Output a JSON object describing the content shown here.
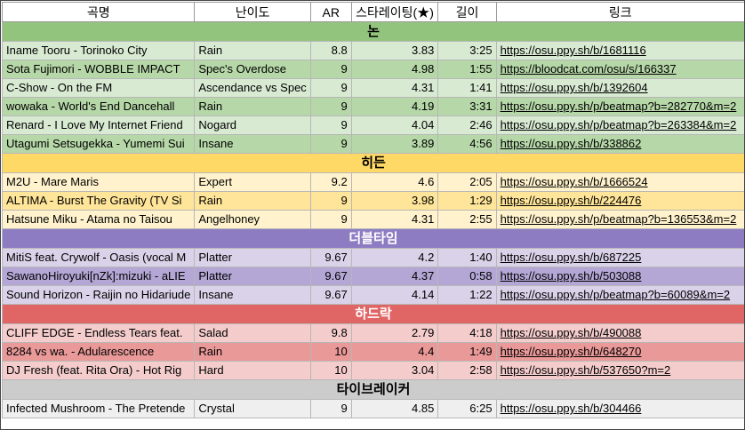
{
  "headers": {
    "song": "곡명",
    "difficulty": "난이도",
    "ar": "AR",
    "star_rating": "스타레이팅(★)",
    "length": "길이",
    "link": "링크"
  },
  "sections": {
    "nomod": {
      "title": "논",
      "rows": [
        {
          "song": "Iname Tooru - Torinoko City",
          "difficulty": "Rain",
          "ar": "8.8",
          "stars": "3.83",
          "length": "3:25",
          "link": "https://osu.ppy.sh/b/1681116"
        },
        {
          "song": "Sota Fujimori - WOBBLE IMPACT",
          "difficulty": "Spec's Overdose",
          "ar": "9",
          "stars": "4.98",
          "length": "1:55",
          "link": "https://bloodcat.com/osu/s/166337"
        },
        {
          "song": "C-Show - On the FM",
          "difficulty": "Ascendance vs Spec",
          "ar": "9",
          "stars": "4.31",
          "length": "1:41",
          "link": "https://osu.ppy.sh/b/1392604"
        },
        {
          "song": "wowaka - World's End Dancehall",
          "difficulty": "Rain",
          "ar": "9",
          "stars": "4.19",
          "length": "3:31",
          "link": "https://osu.ppy.sh/p/beatmap?b=282770&m=2"
        },
        {
          "song": "Renard - I Love My Internet Friend",
          "difficulty": "Nogard",
          "ar": "9",
          "stars": "4.04",
          "length": "2:46",
          "link": "https://osu.ppy.sh/p/beatmap?b=263384&m=2"
        },
        {
          "song": "Utagumi Setsugekka - Yumemi Sui",
          "difficulty": "Insane",
          "ar": "9",
          "stars": "3.89",
          "length": "4:56",
          "link": "https://osu.ppy.sh/b/338862"
        }
      ]
    },
    "hidden": {
      "title": "히든",
      "rows": [
        {
          "song": "M2U - Mare Maris",
          "difficulty": "Expert",
          "ar": "9.2",
          "stars": "4.6",
          "length": "2:05",
          "link": "https://osu.ppy.sh/b/1666524"
        },
        {
          "song": "ALTIMA - Burst The Gravity (TV Si",
          "difficulty": "Rain",
          "ar": "9",
          "stars": "3.98",
          "length": "1:29",
          "link": "https://osu.ppy.sh/b/224476"
        },
        {
          "song": "Hatsune Miku - Atama no Taisou",
          "difficulty": "Angelhoney",
          "ar": "9",
          "stars": "4.31",
          "length": "2:55",
          "link": "https://osu.ppy.sh/p/beatmap?b=136553&m=2"
        }
      ]
    },
    "doubletime": {
      "title": "더블타임",
      "rows": [
        {
          "song": "MitiS feat. Crywolf - Oasis (vocal M",
          "difficulty": "Platter",
          "ar": "9.67",
          "stars": "4.2",
          "length": "1:40",
          "link": "https://osu.ppy.sh/b/687225"
        },
        {
          "song": "SawanoHiroyuki[nZk]:mizuki - aLIE",
          "difficulty": "Platter",
          "ar": "9.67",
          "stars": "4.37",
          "length": "0:58",
          "link": "https://osu.ppy.sh/b/503088"
        },
        {
          "song": "Sound Horizon - Raijin no Hidariude",
          "difficulty": "Insane",
          "ar": "9.67",
          "stars": "4.14",
          "length": "1:22",
          "link": "https://osu.ppy.sh/p/beatmap?b=60089&m=2"
        }
      ]
    },
    "hardrock": {
      "title": "하드락",
      "rows": [
        {
          "song": "CLIFF EDGE - Endless Tears feat.",
          "difficulty": "Salad",
          "ar": "9.8",
          "stars": "2.79",
          "length": "4:18",
          "link": "https://osu.ppy.sh/b/490088"
        },
        {
          "song": "8284 vs wa. - Adularescence",
          "difficulty": "Rain",
          "ar": "10",
          "stars": "4.4",
          "length": "1:49",
          "link": "https://osu.ppy.sh/b/648270"
        },
        {
          "song": "DJ Fresh (feat. Rita Ora) - Hot Rig",
          "difficulty": "Hard",
          "ar": "10",
          "stars": "3.04",
          "length": "2:58",
          "link": "https://osu.ppy.sh/b/537650?m=2"
        }
      ]
    },
    "timebreaker": {
      "title": "타이브레이커",
      "rows": [
        {
          "song": "Infected Mushroom - The Pretende",
          "difficulty": "Crystal",
          "ar": "9",
          "stars": "4.85",
          "length": "6:25",
          "link": "https://osu.ppy.sh/b/304466"
        }
      ]
    }
  }
}
